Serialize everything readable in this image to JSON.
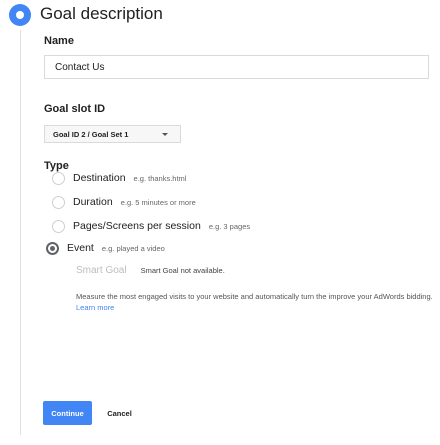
{
  "section": {
    "title": "Goal description"
  },
  "name": {
    "label": "Name",
    "value": "Contact Us"
  },
  "goal_slot": {
    "label": "Goal slot ID",
    "selected": "Goal ID 2 / Goal Set 1"
  },
  "type": {
    "label": "Type",
    "options": [
      {
        "label": "Destination",
        "hint": "e.g. thanks.html",
        "checked": false
      },
      {
        "label": "Duration",
        "hint": "e.g. 5 minutes or more",
        "checked": false
      },
      {
        "label": "Pages/Screens per session",
        "hint": "e.g. 3 pages",
        "checked": false
      },
      {
        "label": "Event",
        "hint": "e.g. played a video",
        "checked": true
      }
    ],
    "smart_goal": {
      "label": "Smart Goal",
      "note": "Smart Goal not available.",
      "description": "Measure the most engaged visits to your website and automatically turn the improve your AdWords bidding.",
      "learn_more": "Learn more"
    }
  },
  "actions": {
    "continue": "Continue",
    "cancel": "Cancel"
  },
  "colors": {
    "accent": "#4285f4",
    "border": "#dadada"
  }
}
